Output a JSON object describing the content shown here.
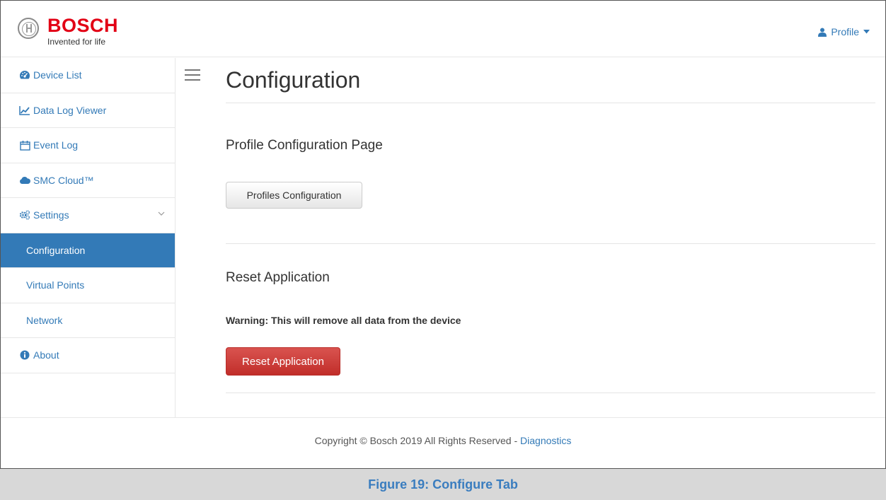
{
  "brand": {
    "name": "BOSCH",
    "tagline": "Invented for life",
    "color": "#e20015"
  },
  "header": {
    "profile_label": "Profile"
  },
  "sidebar": {
    "items": [
      {
        "label": "Device List",
        "icon": "dashboard-icon"
      },
      {
        "label": "Data Log Viewer",
        "icon": "line-chart-icon"
      },
      {
        "label": "Event Log",
        "icon": "calendar-icon"
      },
      {
        "label": "SMC Cloud™",
        "icon": "cloud-icon"
      },
      {
        "label": "Settings",
        "icon": "cogs-icon",
        "expanded": true
      },
      {
        "label": "Configuration",
        "active": true
      },
      {
        "label": "Virtual Points"
      },
      {
        "label": "Network"
      },
      {
        "label": "About",
        "icon": "info-circle-icon"
      }
    ]
  },
  "main": {
    "title": "Configuration",
    "profile_section": {
      "title": "Profile Configuration Page",
      "button_label": "Profiles Configuration"
    },
    "reset_section": {
      "title": "Reset Application",
      "warning": "Warning: This will remove all data from the device",
      "button_label": "Reset Application"
    }
  },
  "footer": {
    "copyright": "Copyright © Bosch 2019 All Rights Reserved - ",
    "link_label": "Diagnostics"
  },
  "caption": "Figure 19: Configure Tab",
  "colors": {
    "accent": "#337ab7",
    "danger": "#d9534f",
    "caption": "#3a7dbf"
  }
}
